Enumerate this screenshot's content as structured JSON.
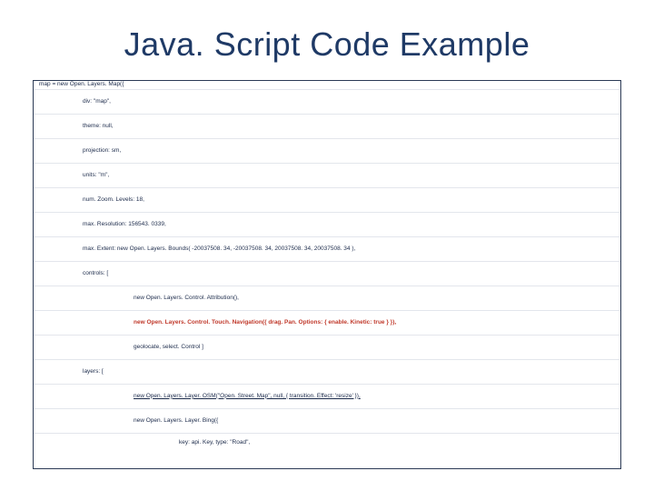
{
  "title": "Java. Script Code Example",
  "code": {
    "l0": "map = new Open. Layers. Map({",
    "l1": "div: \"map\",",
    "l2": "theme: null,",
    "l3": "projection: sm,",
    "l4": "units: \"m\",",
    "l5": "num. Zoom. Levels: 18,",
    "l6": "max. Resolution: 156543. 0339,",
    "l7": "max. Extent: new Open. Layers. Bounds( -20037508. 34, -20037508. 34, 20037508. 34, 20037508. 34 ),",
    "l8": "controls: [",
    "l9": "new Open. Layers. Control. Attribution(),",
    "l10": "new Open. Layers. Control. Touch. Navigation({ drag. Pan. Options: { enable. Kinetic: true } }),",
    "l11": "geolocate, select. Control ]",
    "l12": "layers: [",
    "l13": "new Open. Layers. Layer. OSM(\"Open. Street. Map\", null, { transition. Effect: 'resize' }),",
    "l14": "new Open. Layers. Layer. Bing({",
    "l15": "key: api. Key, type: \"Road\","
  }
}
